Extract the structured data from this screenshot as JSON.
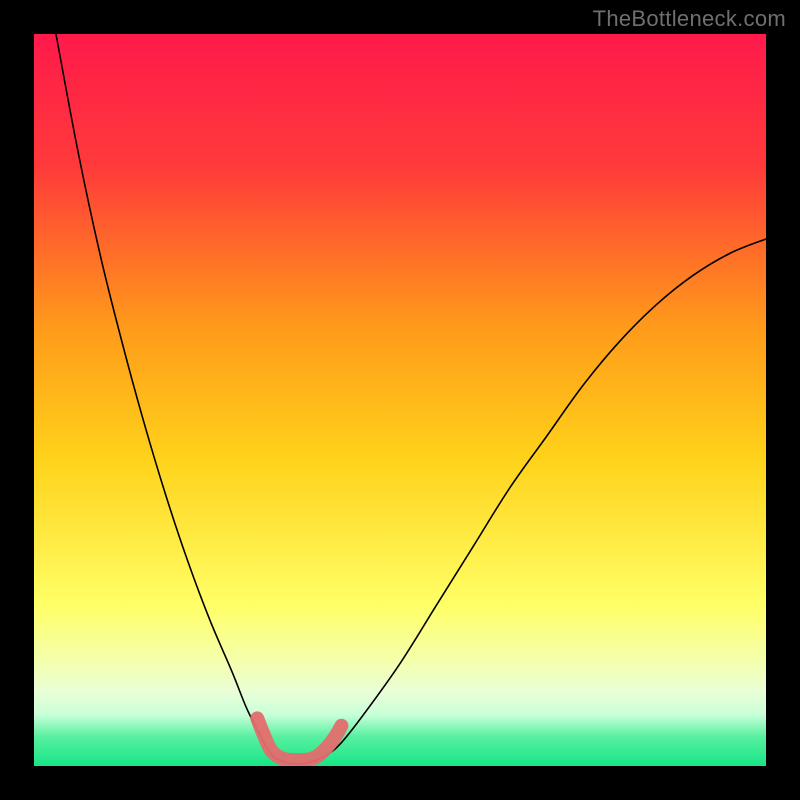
{
  "watermark": "TheBottleneck.com",
  "chart_data": {
    "type": "line",
    "title": "",
    "xlabel": "",
    "ylabel": "",
    "xlim": [
      0,
      100
    ],
    "ylim": [
      0,
      100
    ],
    "background_gradient": {
      "stops": [
        {
          "offset": 0.0,
          "color": "#ff1a4b"
        },
        {
          "offset": 0.18,
          "color": "#ff3a3a"
        },
        {
          "offset": 0.4,
          "color": "#ff9a1a"
        },
        {
          "offset": 0.58,
          "color": "#ffd21a"
        },
        {
          "offset": 0.78,
          "color": "#ffff66"
        },
        {
          "offset": 0.86,
          "color": "#f4ffb0"
        },
        {
          "offset": 0.9,
          "color": "#e8ffd8"
        },
        {
          "offset": 0.93,
          "color": "#c8ffd8"
        },
        {
          "offset": 0.96,
          "color": "#58f0a0"
        },
        {
          "offset": 1.0,
          "color": "#17e586"
        }
      ]
    },
    "series": [
      {
        "name": "bottleneck-curve",
        "color": "#000000",
        "width": 1.6,
        "points": [
          {
            "x": 3,
            "y": 100
          },
          {
            "x": 6,
            "y": 84
          },
          {
            "x": 9,
            "y": 70
          },
          {
            "x": 12,
            "y": 58
          },
          {
            "x": 15,
            "y": 47
          },
          {
            "x": 18,
            "y": 37
          },
          {
            "x": 21,
            "y": 28
          },
          {
            "x": 24,
            "y": 20
          },
          {
            "x": 27,
            "y": 13
          },
          {
            "x": 29,
            "y": 8
          },
          {
            "x": 30.5,
            "y": 5
          },
          {
            "x": 31.5,
            "y": 3
          },
          {
            "x": 32.5,
            "y": 1.5
          },
          {
            "x": 34,
            "y": 0.6
          },
          {
            "x": 36,
            "y": 0.3
          },
          {
            "x": 38,
            "y": 0.6
          },
          {
            "x": 40,
            "y": 1.5
          },
          {
            "x": 42,
            "y": 3.2
          },
          {
            "x": 45,
            "y": 7
          },
          {
            "x": 50,
            "y": 14
          },
          {
            "x": 55,
            "y": 22
          },
          {
            "x": 60,
            "y": 30
          },
          {
            "x": 65,
            "y": 38
          },
          {
            "x": 70,
            "y": 45
          },
          {
            "x": 75,
            "y": 52
          },
          {
            "x": 80,
            "y": 58
          },
          {
            "x": 85,
            "y": 63
          },
          {
            "x": 90,
            "y": 67
          },
          {
            "x": 95,
            "y": 70
          },
          {
            "x": 100,
            "y": 72
          }
        ]
      },
      {
        "name": "marker-band",
        "color": "#e46d6e",
        "width": 14,
        "linecap": "round",
        "points": [
          {
            "x": 30.5,
            "y": 6.5
          },
          {
            "x": 31.5,
            "y": 4.0
          },
          {
            "x": 32.5,
            "y": 2.0
          },
          {
            "x": 34.0,
            "y": 1.0
          },
          {
            "x": 36.0,
            "y": 0.8
          },
          {
            "x": 38.0,
            "y": 1.0
          },
          {
            "x": 39.5,
            "y": 2.0
          },
          {
            "x": 41.0,
            "y": 3.8
          },
          {
            "x": 42.0,
            "y": 5.5
          }
        ]
      }
    ]
  }
}
